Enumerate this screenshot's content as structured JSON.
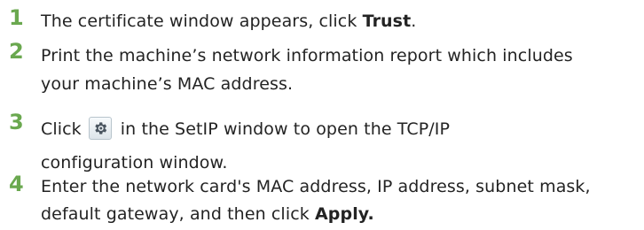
{
  "steps": [
    {
      "number": "1",
      "text_before": "The certificate window appears, click ",
      "bold": "Trust",
      "text_after": "."
    },
    {
      "number": "2",
      "text": "Print the machine’s network information report which includes your machine’s MAC address."
    },
    {
      "number": "3",
      "text_before": "Click",
      "icon": "settings-gear-icon",
      "text_after": "in the SetIP window to open the TCP/IP configuration window."
    },
    {
      "number": "4",
      "text_before": "Enter the network card's MAC address, IP address, subnet mask, default gateway, and then click ",
      "bold": "Apply."
    }
  ],
  "colors": {
    "step_number": "#6aa84f",
    "text": "#232323",
    "icon_border": "#b8c4cc",
    "icon_fill": "#4a5560"
  }
}
